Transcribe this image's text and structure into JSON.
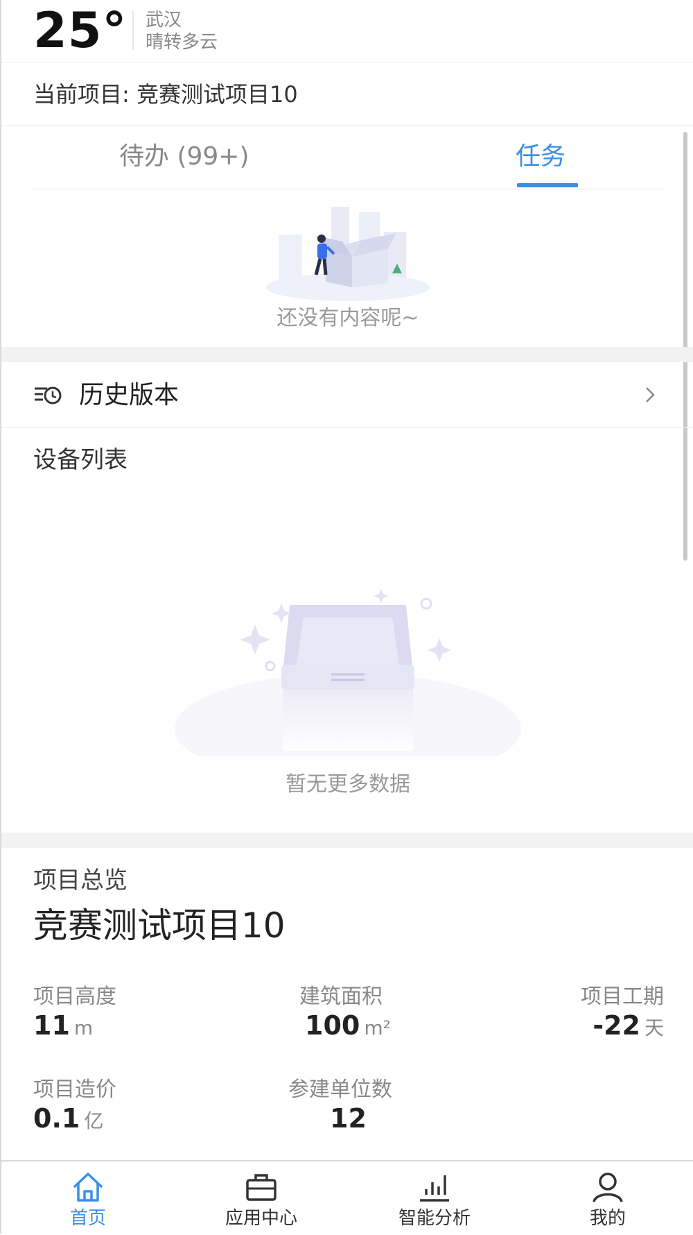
{
  "header": {
    "temperature": "25°",
    "city": "武汉",
    "condition": "晴转多云"
  },
  "current_project": {
    "label": "当前项目: 竞赛测试项目10"
  },
  "tabs": {
    "todo_label": "待办 (99+)",
    "task_label": "任务",
    "active": "任务"
  },
  "task_empty": {
    "text": "还没有内容呢~"
  },
  "history": {
    "label": "历史版本",
    "icon": "history-version-icon"
  },
  "device_list": {
    "title": "设备列表",
    "empty_text": "暂无更多数据"
  },
  "overview": {
    "section_label": "项目总览",
    "project_name": "竞赛测试项目10",
    "stats": {
      "height": {
        "label": "项目高度",
        "value": "11",
        "unit": "m"
      },
      "area": {
        "label": "建筑面积",
        "value": "100",
        "unit": "m²"
      },
      "period": {
        "label": "项目工期",
        "value": "-22",
        "unit": "天"
      },
      "cost": {
        "label": "项目造价",
        "value": "0.1",
        "unit": "亿"
      },
      "units": {
        "label": "参建单位数",
        "value": "12"
      }
    }
  },
  "nav": {
    "home": "首页",
    "apps": "应用中心",
    "analysis": "智能分析",
    "mine": "我的"
  },
  "colors": {
    "accent": "#3a8ee6",
    "muted": "#888888"
  }
}
